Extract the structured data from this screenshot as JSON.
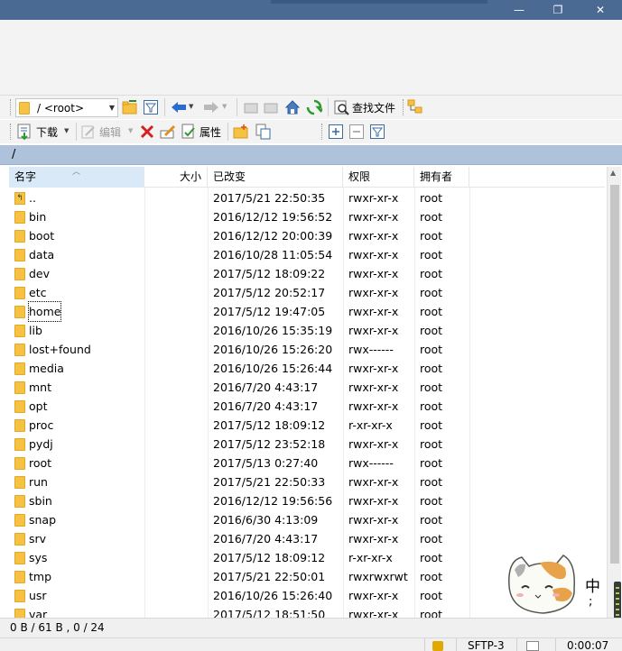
{
  "window": {
    "min_glyph": "—",
    "max_glyph": "❐",
    "close_glyph": "✕"
  },
  "toolbar1": {
    "path_value": "/ <root>",
    "find_files_label": "查找文件"
  },
  "toolbar2": {
    "download_label": "下载",
    "edit_label": "编辑",
    "properties_label": "属性"
  },
  "path_bar": {
    "path": "/"
  },
  "columns": {
    "name": "名字",
    "size": "大小",
    "changed": "已改变",
    "rights": "权限",
    "owner": "拥有者"
  },
  "rows": [
    {
      "name": "..",
      "changed": "2017/5/21 22:50:35",
      "rights": "rwxr-xr-x",
      "owner": "root",
      "kind": "parent"
    },
    {
      "name": "bin",
      "changed": "2016/12/12 19:56:52",
      "rights": "rwxr-xr-x",
      "owner": "root",
      "kind": "folder"
    },
    {
      "name": "boot",
      "changed": "2016/12/12 20:00:39",
      "rights": "rwxr-xr-x",
      "owner": "root",
      "kind": "folder"
    },
    {
      "name": "data",
      "changed": "2016/10/28 11:05:54",
      "rights": "rwxr-xr-x",
      "owner": "root",
      "kind": "folder"
    },
    {
      "name": "dev",
      "changed": "2017/5/12 18:09:22",
      "rights": "rwxr-xr-x",
      "owner": "root",
      "kind": "folder"
    },
    {
      "name": "etc",
      "changed": "2017/5/12 20:52:17",
      "rights": "rwxr-xr-x",
      "owner": "root",
      "kind": "folder"
    },
    {
      "name": "home",
      "changed": "2017/5/12 19:47:05",
      "rights": "rwxr-xr-x",
      "owner": "root",
      "kind": "folder",
      "focused": true
    },
    {
      "name": "lib",
      "changed": "2016/10/26 15:35:19",
      "rights": "rwxr-xr-x",
      "owner": "root",
      "kind": "folder"
    },
    {
      "name": "lost+found",
      "changed": "2016/10/26 15:26:20",
      "rights": "rwx------",
      "owner": "root",
      "kind": "folder"
    },
    {
      "name": "media",
      "changed": "2016/10/26 15:26:44",
      "rights": "rwxr-xr-x",
      "owner": "root",
      "kind": "folder"
    },
    {
      "name": "mnt",
      "changed": "2016/7/20 4:43:17",
      "rights": "rwxr-xr-x",
      "owner": "root",
      "kind": "folder"
    },
    {
      "name": "opt",
      "changed": "2016/7/20 4:43:17",
      "rights": "rwxr-xr-x",
      "owner": "root",
      "kind": "folder"
    },
    {
      "name": "proc",
      "changed": "2017/5/12 18:09:12",
      "rights": "r-xr-xr-x",
      "owner": "root",
      "kind": "folder"
    },
    {
      "name": "pydj",
      "changed": "2017/5/12 23:52:18",
      "rights": "rwxr-xr-x",
      "owner": "root",
      "kind": "folder"
    },
    {
      "name": "root",
      "changed": "2017/5/13 0:27:40",
      "rights": "rwx------",
      "owner": "root",
      "kind": "folder"
    },
    {
      "name": "run",
      "changed": "2017/5/21 22:50:33",
      "rights": "rwxr-xr-x",
      "owner": "root",
      "kind": "folder"
    },
    {
      "name": "sbin",
      "changed": "2016/12/12 19:56:56",
      "rights": "rwxr-xr-x",
      "owner": "root",
      "kind": "folder"
    },
    {
      "name": "snap",
      "changed": "2016/6/30 4:13:09",
      "rights": "rwxr-xr-x",
      "owner": "root",
      "kind": "folder"
    },
    {
      "name": "srv",
      "changed": "2016/7/20 4:43:17",
      "rights": "rwxr-xr-x",
      "owner": "root",
      "kind": "folder"
    },
    {
      "name": "sys",
      "changed": "2017/5/12 18:09:12",
      "rights": "r-xr-xr-x",
      "owner": "root",
      "kind": "folder"
    },
    {
      "name": "tmp",
      "changed": "2017/5/21 22:50:01",
      "rights": "rwxrwxrwt",
      "owner": "root",
      "kind": "folder"
    },
    {
      "name": "usr",
      "changed": "2016/10/26 15:26:40",
      "rights": "rwxr-xr-x",
      "owner": "root",
      "kind": "folder"
    },
    {
      "name": "var",
      "changed": "2017/5/12 18:51:50",
      "rights": "rwxr-xr-x",
      "owner": "root",
      "kind": "folder"
    }
  ],
  "status": {
    "selection": "0 B / 61 B , 0 / 24",
    "protocol": "SFTP-3",
    "elapsed": "0:00:07"
  },
  "ime": {
    "mode": "中",
    "punct": ";"
  },
  "colors": {
    "titlebar": "#4a6a94",
    "path_bar": "#aec3db",
    "header_sorted": "#d9e9f7",
    "folder": "#f6c244"
  }
}
